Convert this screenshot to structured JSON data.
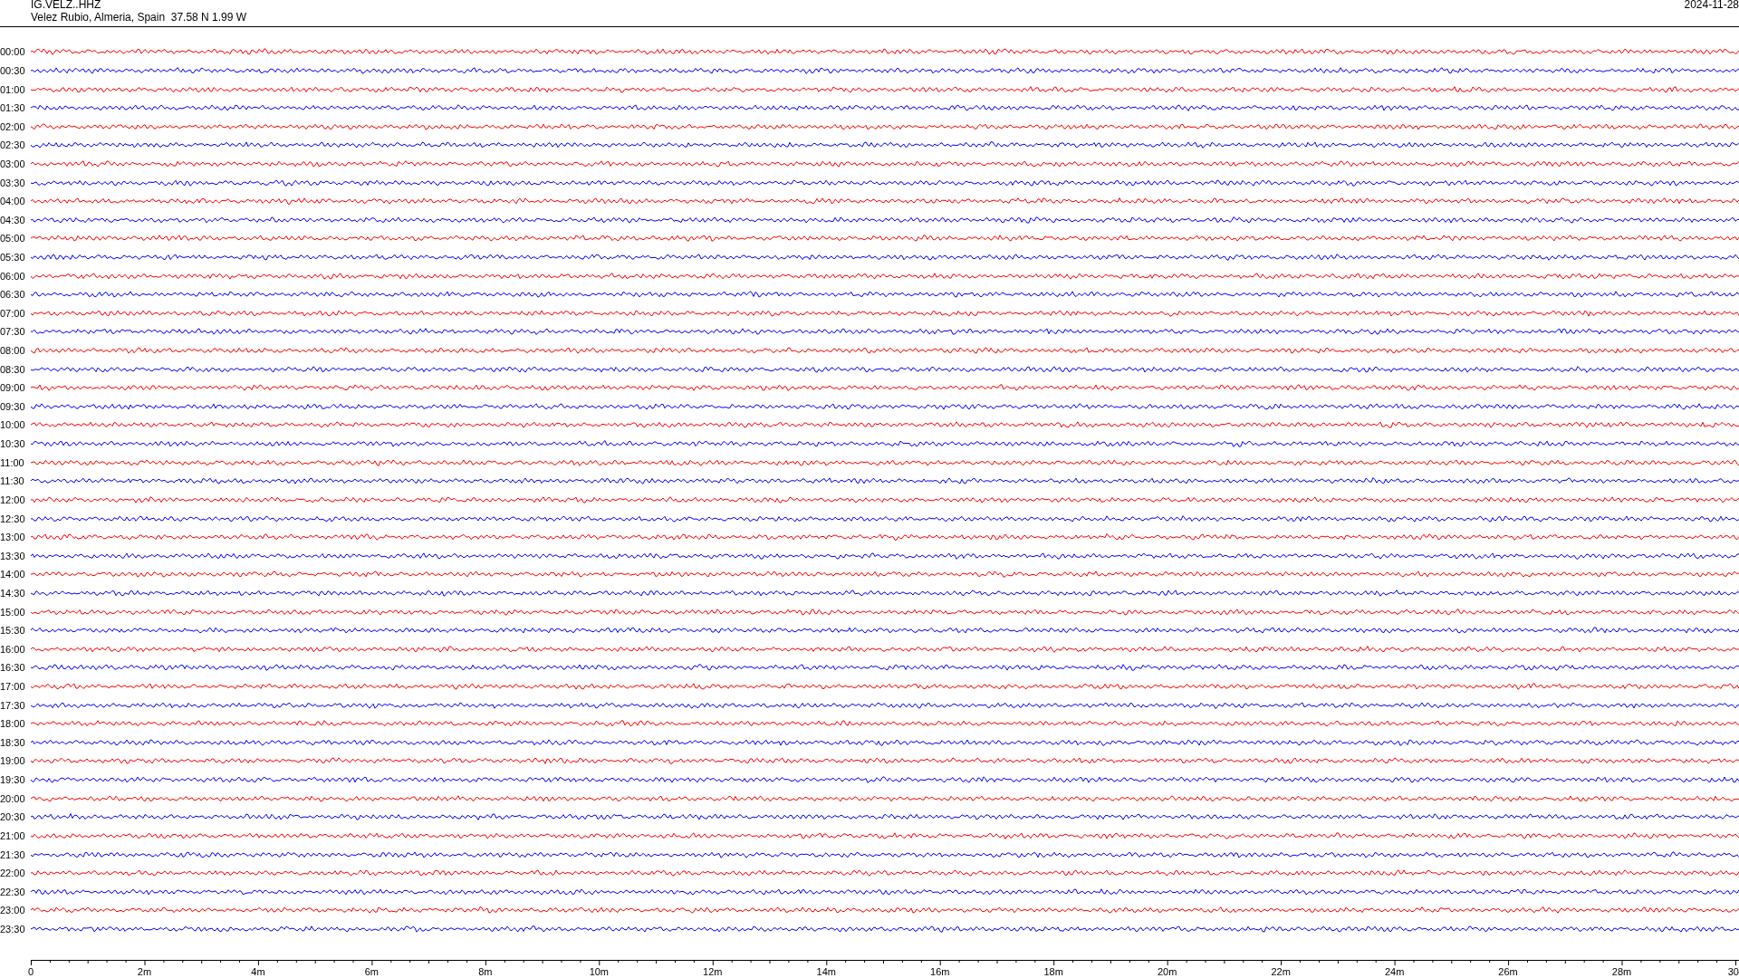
{
  "header": {
    "station": "IG.VELZ..HHZ",
    "location": "Velez Rubio, Almeria, Spain  37.58 N 1.99 W",
    "date": "2024-11-28"
  },
  "rows": [
    {
      "time": "00:00",
      "color": "#ff0000"
    },
    {
      "time": "00:30",
      "color": "#0000ff"
    },
    {
      "time": "01:00",
      "color": "#ff0000"
    },
    {
      "time": "01:30",
      "color": "#0000ff"
    },
    {
      "time": "02:00",
      "color": "#ff0000"
    },
    {
      "time": "02:30",
      "color": "#0000ff"
    },
    {
      "time": "03:00",
      "color": "#ff0000"
    },
    {
      "time": "03:30",
      "color": "#0000ff"
    },
    {
      "time": "04:00",
      "color": "#ff0000"
    },
    {
      "time": "04:30",
      "color": "#0000ff"
    },
    {
      "time": "05:00",
      "color": "#ff0000"
    },
    {
      "time": "05:30",
      "color": "#0000ff"
    },
    {
      "time": "06:00",
      "color": "#ff0000"
    },
    {
      "time": "06:30",
      "color": "#0000ff"
    },
    {
      "time": "07:00",
      "color": "#ff0000"
    },
    {
      "time": "07:30",
      "color": "#0000ff"
    },
    {
      "time": "08:00",
      "color": "#ff0000"
    },
    {
      "time": "08:30",
      "color": "#0000ff"
    },
    {
      "time": "09:00",
      "color": "#ff0000"
    },
    {
      "time": "09:30",
      "color": "#0000ff"
    },
    {
      "time": "10:00",
      "color": "#ff0000"
    },
    {
      "time": "10:30",
      "color": "#0000ff"
    },
    {
      "time": "11:00",
      "color": "#ff0000"
    },
    {
      "time": "11:30",
      "color": "#0000ff"
    },
    {
      "time": "12:00",
      "color": "#ff0000"
    },
    {
      "time": "12:30",
      "color": "#0000ff"
    },
    {
      "time": "13:00",
      "color": "#ff0000"
    },
    {
      "time": "13:30",
      "color": "#0000ff"
    },
    {
      "time": "14:00",
      "color": "#ff0000"
    },
    {
      "time": "14:30",
      "color": "#0000ff"
    },
    {
      "time": "15:00",
      "color": "#ff0000"
    },
    {
      "time": "15:30",
      "color": "#0000ff"
    },
    {
      "time": "16:00",
      "color": "#ff0000"
    },
    {
      "time": "16:30",
      "color": "#0000ff"
    },
    {
      "time": "17:00",
      "color": "#ff0000"
    },
    {
      "time": "17:30",
      "color": "#0000ff"
    },
    {
      "time": "18:00",
      "color": "#ff0000"
    },
    {
      "time": "18:30",
      "color": "#0000ff"
    },
    {
      "time": "19:00",
      "color": "#ff0000"
    },
    {
      "time": "19:30",
      "color": "#0000ff"
    },
    {
      "time": "20:00",
      "color": "#ff0000"
    },
    {
      "time": "20:30",
      "color": "#0000ff"
    },
    {
      "time": "21:00",
      "color": "#ff0000"
    },
    {
      "time": "21:30",
      "color": "#0000ff"
    },
    {
      "time": "22:00",
      "color": "#ff0000"
    },
    {
      "time": "22:30",
      "color": "#0000ff"
    },
    {
      "time": "23:00",
      "color": "#ff0000"
    },
    {
      "time": "23:30",
      "color": "#0000ff"
    }
  ],
  "time_axis": {
    "ticks": [
      "0",
      "2m",
      "4m",
      "6m",
      "8m",
      "10m",
      "12m",
      "14m",
      "16m",
      "18m",
      "20m",
      "22m",
      "24m",
      "26m",
      "28m",
      "30"
    ]
  }
}
